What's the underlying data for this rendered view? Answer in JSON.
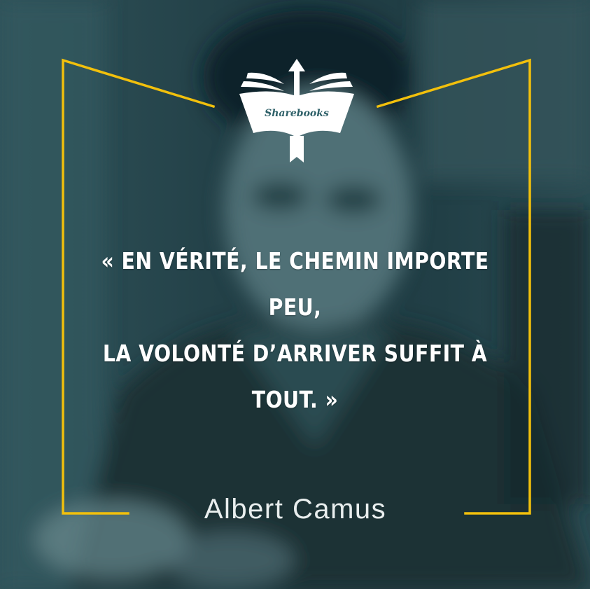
{
  "logo": {
    "text": "Sharebooks"
  },
  "quote": {
    "lines": [
      "« EN VÉRITÉ, LE CHEMIN IMPORTE PEU,",
      "LA VOLONTÉ D’ARRIVER SUFFIT À",
      "TOUT. »"
    ]
  },
  "author": "Albert Camus",
  "colors": {
    "frame": "#f2c00c",
    "overlay": "#1f3d44",
    "text": "#ffffff"
  }
}
